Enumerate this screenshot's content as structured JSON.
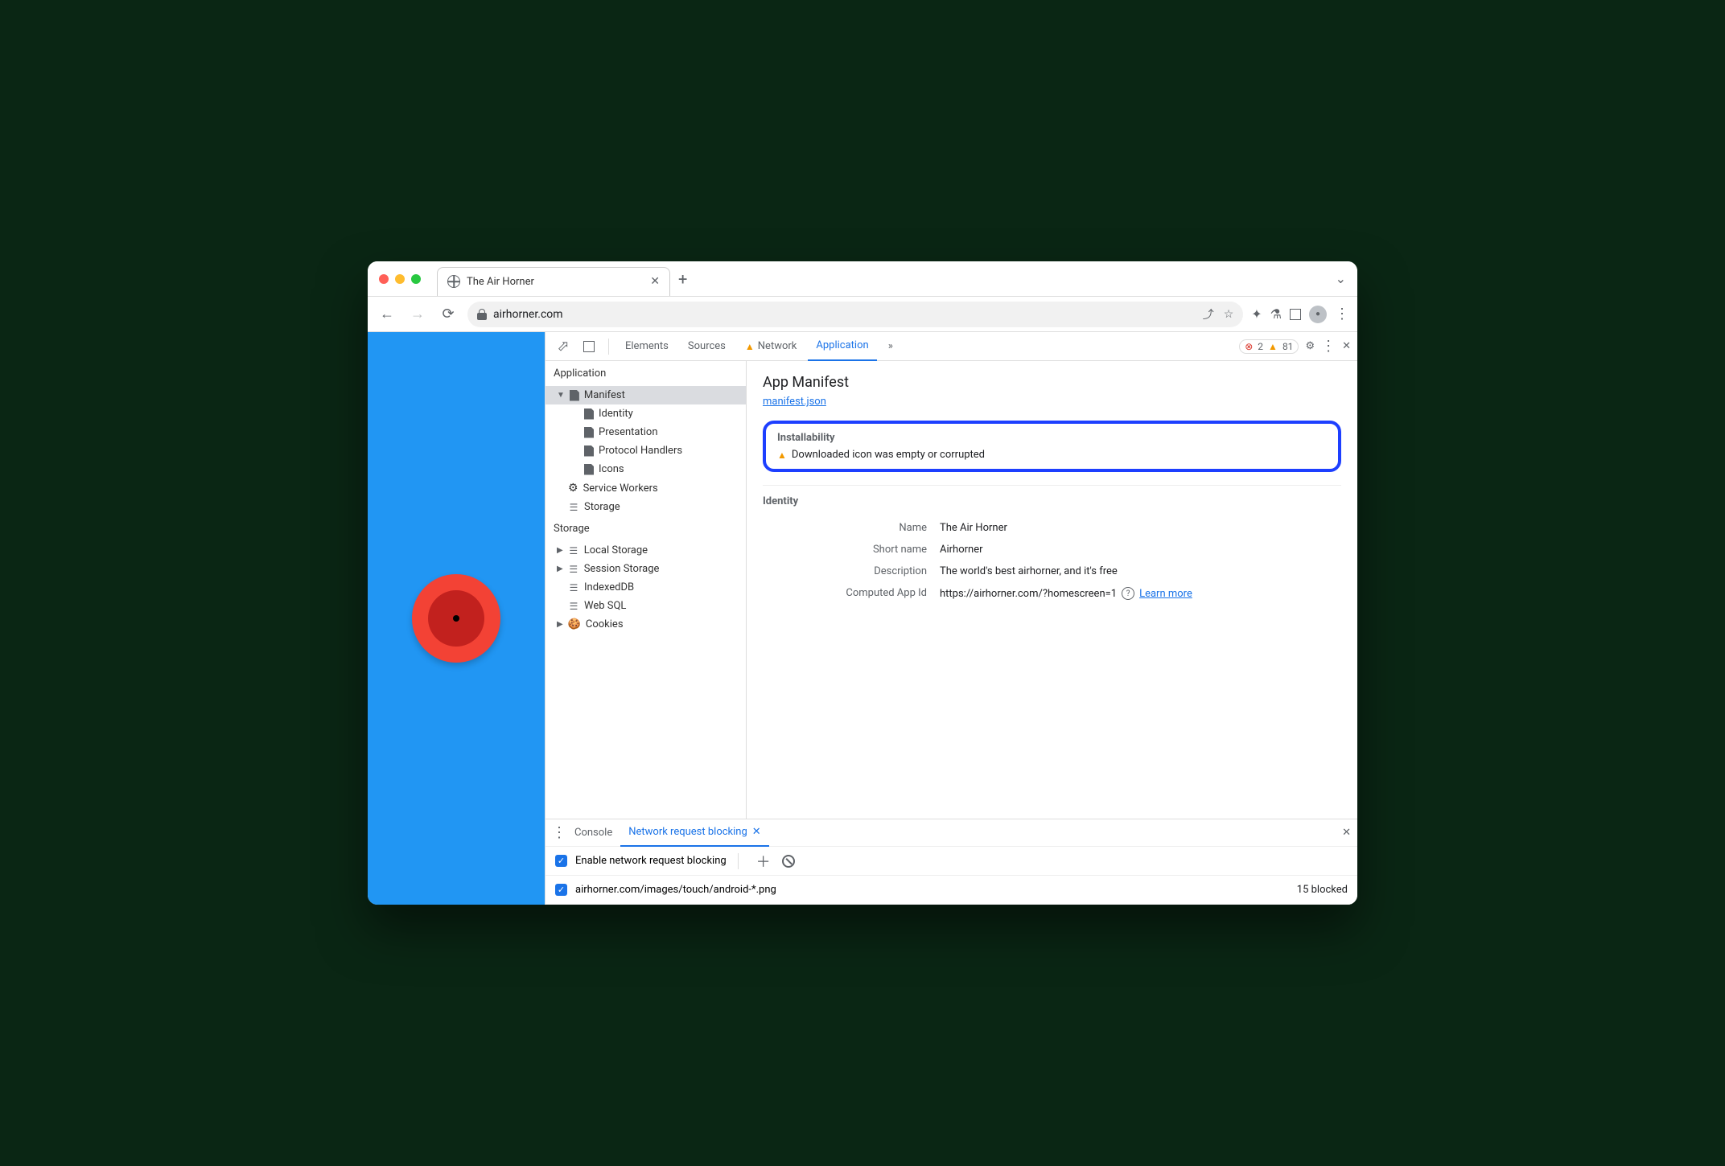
{
  "browser": {
    "tab_title": "The Air Horner",
    "url": "airhorner.com"
  },
  "devtools": {
    "tabs": [
      "Elements",
      "Sources",
      "Network",
      "Application"
    ],
    "active_tab": "Application",
    "error_count": "2",
    "warning_count": "81"
  },
  "sidebar": {
    "application": {
      "title": "Application",
      "manifest": "Manifest",
      "identity": "Identity",
      "presentation": "Presentation",
      "protocol_handlers": "Protocol Handlers",
      "icons": "Icons",
      "service_workers": "Service Workers",
      "storage_item": "Storage"
    },
    "storage": {
      "title": "Storage",
      "local_storage": "Local Storage",
      "session_storage": "Session Storage",
      "indexeddb": "IndexedDB",
      "web_sql": "Web SQL",
      "cookies": "Cookies"
    }
  },
  "manifest": {
    "title": "App Manifest",
    "link": "manifest.json",
    "installability_title": "Installability",
    "installability_msg": "Downloaded icon was empty or corrupted",
    "identity_title": "Identity",
    "name_label": "Name",
    "name_value": "The Air Horner",
    "short_name_label": "Short name",
    "short_name_value": "Airhorner",
    "description_label": "Description",
    "description_value": "The world's best airhorner, and it's free",
    "app_id_label": "Computed App Id",
    "app_id_value": "https://airhorner.com/?homescreen=1",
    "learn_more": "Learn more"
  },
  "drawer": {
    "console_tab": "Console",
    "blocking_tab": "Network request blocking",
    "enable_label": "Enable network request blocking",
    "pattern": "airhorner.com/images/touch/android-*.png",
    "blocked_count": "15 blocked"
  }
}
